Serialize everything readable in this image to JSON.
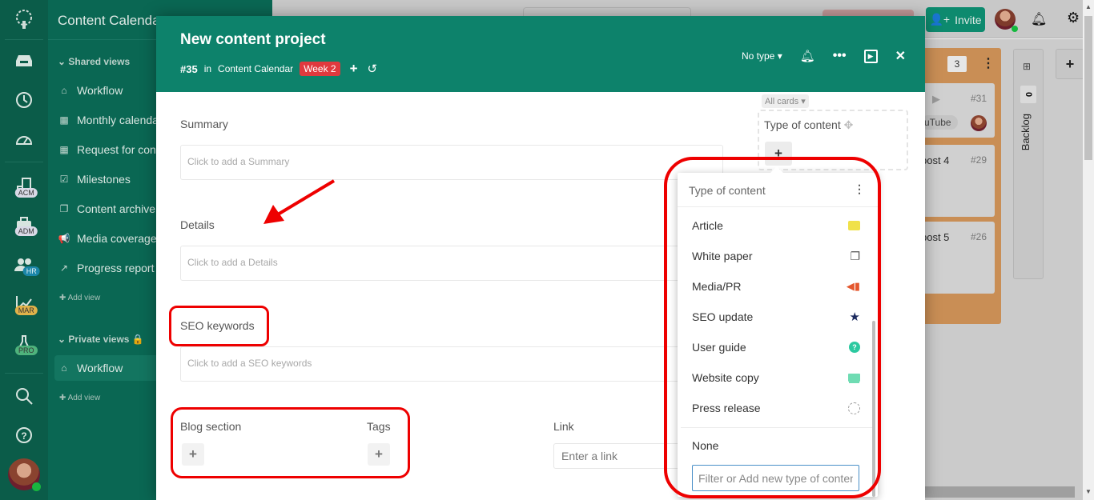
{
  "app": {
    "workspace_title": "Content Calendar",
    "rail": {
      "top_icons": [
        "logo-tree-icon",
        "inbox-icon",
        "clock-icon",
        "dashboard-gauge-icon"
      ],
      "spaces": [
        {
          "icon": "building-icon",
          "badge": "ACM",
          "badge_color": "#d9d9e6"
        },
        {
          "icon": "briefcase-icon",
          "badge": "ADM",
          "badge_color": "#d9d9e6"
        },
        {
          "icon": "people-icon",
          "badge": "HR",
          "badge_color": "#1b86a8"
        },
        {
          "icon": "chart-line-icon",
          "badge": "MAR",
          "badge_color": "#e0b24a"
        },
        {
          "icon": "flask-icon",
          "badge": "PRO",
          "badge_color": "#4fb37c"
        }
      ],
      "bottom_icons": [
        "search-icon",
        "help-icon",
        "user-avatar"
      ]
    },
    "shared_views": {
      "heading": "Shared views",
      "items": [
        {
          "icon": "home-icon",
          "label": "Workflow"
        },
        {
          "icon": "calendar-grid-icon",
          "label": "Monthly calendar"
        },
        {
          "icon": "calendar-grid-icon",
          "label": "Request for content"
        },
        {
          "icon": "calendar-check-icon",
          "label": "Milestones"
        },
        {
          "icon": "copy-icon",
          "label": "Content archive"
        },
        {
          "icon": "megaphone-icon",
          "label": "Media coverage"
        },
        {
          "icon": "chart-line-icon",
          "label": "Progress report"
        }
      ],
      "add_view": "Add view"
    },
    "private_views": {
      "heading": "Private views",
      "items": [
        {
          "icon": "home-icon",
          "label": "Workflow",
          "active": true
        }
      ],
      "add_view": "Add view"
    },
    "topbar": {
      "invite_label": "Invite"
    },
    "board": {
      "column_count": "3",
      "cards": [
        {
          "title_fragment": "uTube",
          "number": "#31"
        },
        {
          "title_fragment": "post 4",
          "number": "#29"
        },
        {
          "title_fragment": "post 5",
          "number": "#26"
        }
      ],
      "backlog": {
        "label": "Backlog",
        "count": "0"
      }
    }
  },
  "modal": {
    "title": "New content project",
    "id": "#35",
    "in_label": "in",
    "project": "Content Calendar",
    "week_badge": "Week 2",
    "type_select": "No type",
    "accent_color": "#0d826b",
    "fields": {
      "summary": {
        "label": "Summary",
        "placeholder": "Click to add a Summary"
      },
      "details": {
        "label": "Details",
        "placeholder": "Click to add a Details"
      },
      "seo_keywords": {
        "label": "SEO keywords",
        "placeholder": "Click to add a SEO keywords"
      },
      "blog_section": {
        "label": "Blog section"
      },
      "tags": {
        "label": "Tags"
      },
      "link": {
        "label": "Link",
        "placeholder": "Enter a link"
      }
    },
    "right_panel": {
      "filter": "All cards",
      "type_of_content_label": "Type of content"
    }
  },
  "dropdown": {
    "title": "Type of content",
    "options": [
      {
        "label": "Article",
        "icon": "newspaper-icon",
        "color": "#f0e14a"
      },
      {
        "label": "White paper",
        "icon": "copy-icon",
        "color": "#555555"
      },
      {
        "label": "Media/PR",
        "icon": "megaphone-icon",
        "color": "#e4572e"
      },
      {
        "label": "SEO update",
        "icon": "star-icon",
        "color": "#1b2a5e"
      },
      {
        "label": "User guide",
        "icon": "question-circle-icon",
        "color": "#2cc9a0"
      },
      {
        "label": "Website copy",
        "icon": "monitor-icon",
        "color": "#6fdcb3"
      },
      {
        "label": "Press release",
        "icon": "dashed-circle-icon",
        "color": "#999999"
      }
    ],
    "none_label": "None",
    "filter_placeholder": "Filter or Add new type of content"
  }
}
